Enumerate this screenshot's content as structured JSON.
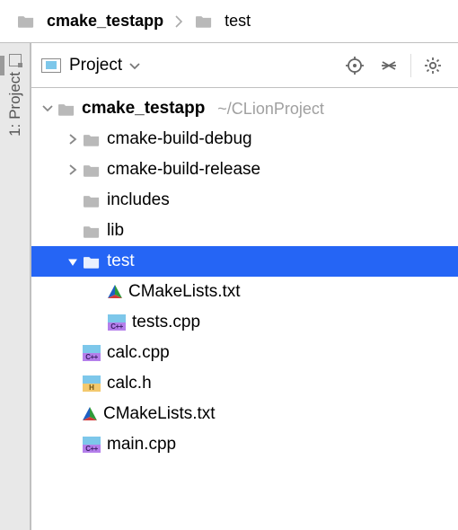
{
  "breadcrumbs": [
    {
      "label": "cmake_testapp",
      "bold": true
    },
    {
      "label": "test",
      "bold": false
    }
  ],
  "sidebar": {
    "tab": "1: Project"
  },
  "panel": {
    "title": "Project"
  },
  "tree": {
    "root": {
      "label": "cmake_testapp",
      "hint": "~/CLionProject",
      "expanded": true
    },
    "items": [
      {
        "type": "folder",
        "label": "cmake-build-debug",
        "depth": 1,
        "expanded": false,
        "arrow": "right"
      },
      {
        "type": "folder",
        "label": "cmake-build-release",
        "depth": 1,
        "expanded": false,
        "arrow": "right"
      },
      {
        "type": "folder",
        "label": "includes",
        "depth": 1,
        "arrow": "none"
      },
      {
        "type": "folder",
        "label": "lib",
        "depth": 1,
        "arrow": "none"
      },
      {
        "type": "folder",
        "label": "test",
        "depth": 1,
        "expanded": true,
        "arrow": "down",
        "selected": true
      },
      {
        "type": "cmake",
        "label": "CMakeLists.txt",
        "depth": 2
      },
      {
        "type": "cpp",
        "label": "tests.cpp",
        "depth": 2
      },
      {
        "type": "cpp",
        "label": "calc.cpp",
        "depth": 1
      },
      {
        "type": "h",
        "label": "calc.h",
        "depth": 1
      },
      {
        "type": "cmake",
        "label": "CMakeLists.txt",
        "depth": 1
      },
      {
        "type": "cpp",
        "label": "main.cpp",
        "depth": 1
      }
    ]
  },
  "icon_badges": {
    "cpp": "C++",
    "h": "H"
  }
}
